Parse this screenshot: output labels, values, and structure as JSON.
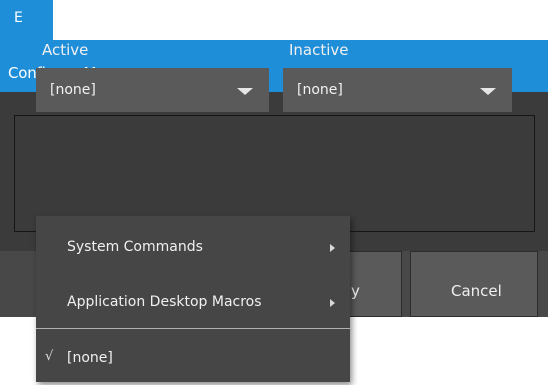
{
  "tab": {
    "label": "E"
  },
  "dialog": {
    "title": "Configure Macros..."
  },
  "fields": [
    {
      "label": "Active",
      "value": "[none]"
    },
    {
      "label": "Inactive",
      "value": "[none]"
    }
  ],
  "buttons": {
    "ok_partial": "y",
    "cancel": "Cancel"
  },
  "menu": {
    "items": [
      {
        "label": "System Commands",
        "submenu_icon": "chevron-right-icon"
      },
      {
        "label": "Application Desktop Macros",
        "submenu_icon": "chevron-right-icon"
      }
    ],
    "selected": {
      "check": "√",
      "label": "[none]"
    }
  },
  "colors": {
    "accent": "#1f8ed9",
    "dialog_bg": "#3b3b3b",
    "control_bg": "#5a5a5a",
    "menu_bg": "#464646"
  }
}
